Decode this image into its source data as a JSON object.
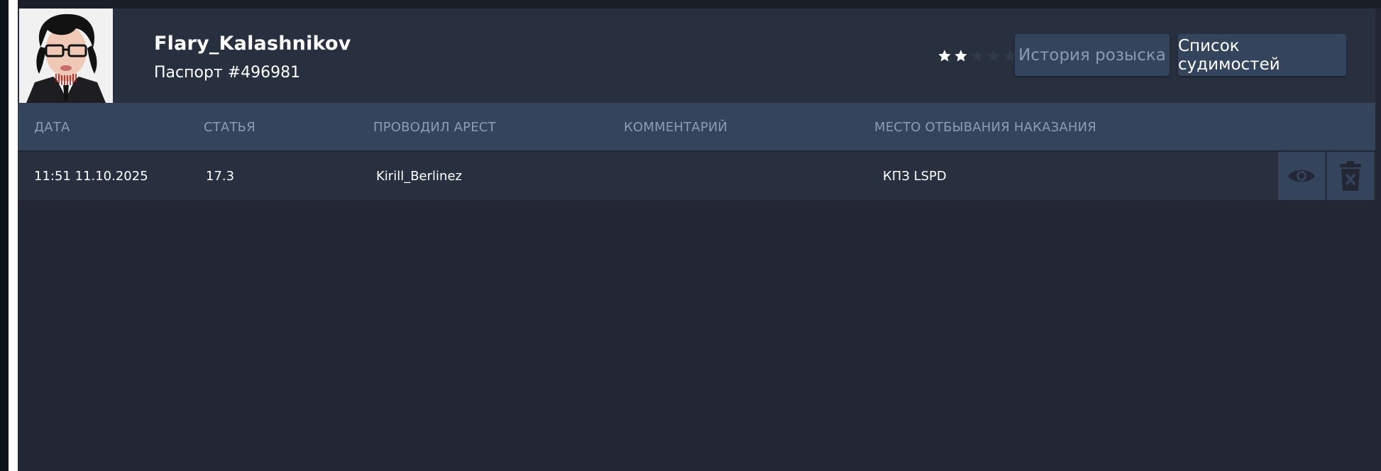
{
  "profile": {
    "name": "Flary_Kalashnikov",
    "passport": "Паспорт #496981",
    "wanted_level": 2,
    "wanted_max": 5
  },
  "actions": {
    "history_label": "История розыска",
    "convictions_label": "Список судимостей"
  },
  "table": {
    "columns": [
      "ДАТА",
      "СТАТЬЯ",
      "ПРОВОДИЛ АРЕСТ",
      "КОММЕНТАРИЙ",
      "МЕСТО ОТБЫВАНИЯ НАКАЗАНИЯ"
    ],
    "rows": [
      {
        "date": "11:51 11.10.2025",
        "article": "17.3",
        "arrested_by": "Kirill_Berlinez",
        "comment": "",
        "place": "КПЗ LSPD"
      }
    ]
  },
  "icons": {
    "view": "eye-icon",
    "delete": "trash-x-icon",
    "star": "star-icon"
  },
  "colors": {
    "background": "#222733",
    "header": "#283040",
    "accent_panel": "#34445c",
    "muted_text": "#8c9cb4",
    "star_active": "#ffffff",
    "star_inactive": "#2f3a4a"
  }
}
